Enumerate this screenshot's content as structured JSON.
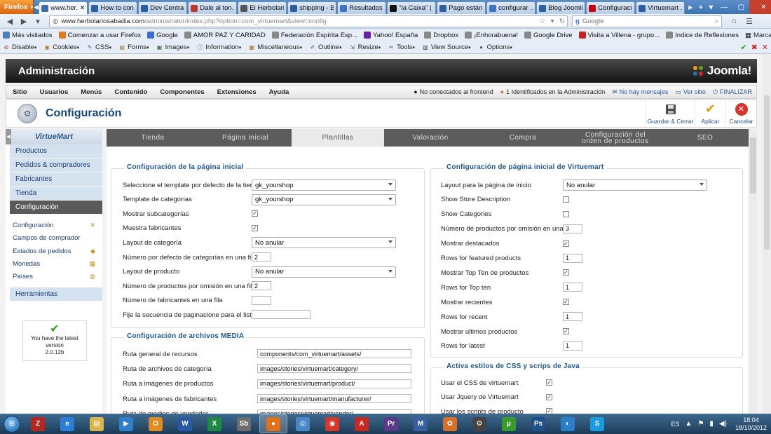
{
  "browser": {
    "menu_button": "Firefox",
    "tabs": [
      {
        "label": "www.her...",
        "color": "#3a6fa8",
        "glyph": "",
        "active": true
      },
      {
        "label": "How to con...",
        "color": "#2c5fa0",
        "glyph": "",
        "active": false
      },
      {
        "label": "Dev Central ...",
        "color": "#2a5d9f",
        "glyph": "",
        "active": false
      },
      {
        "label": "Dale al ton...",
        "color": "#c0392b",
        "glyph": "",
        "active": false
      },
      {
        "label": "El Herbolari...",
        "color": "#555555",
        "glyph": "",
        "active": false
      },
      {
        "label": "shipping - B...",
        "color": "#2c5fa0",
        "glyph": "",
        "active": false
      },
      {
        "label": "Resultados ...",
        "color": "#3b73c7",
        "glyph": "",
        "active": false
      },
      {
        "label": "\"la Caixa\" | ...",
        "color": "#111111",
        "glyph": "",
        "active": false
      },
      {
        "label": "Pago están...",
        "color": "#2c5fa0",
        "glyph": "",
        "active": false
      },
      {
        "label": "configurar ...",
        "color": "#3b73c7",
        "glyph": "",
        "active": false
      },
      {
        "label": "Blog Joomli...",
        "color": "#2c5fa0",
        "glyph": "",
        "active": false
      },
      {
        "label": "Configuraci...",
        "color": "#cc0000",
        "glyph": "",
        "active": false
      },
      {
        "label": "Virtuemart ...",
        "color": "#2c5fa0",
        "glyph": "",
        "active": false
      }
    ],
    "url_host": "www.herbolariosabadia.com",
    "url_path": "/administrator/index.php?option=com_virtuemart&view=config",
    "search_placeholder": "Google",
    "bookmarks": [
      {
        "label": "Más visitados",
        "color": "#4a7fc0"
      },
      {
        "label": "Comenzar a usar Firefox",
        "color": "#e07b1a"
      },
      {
        "label": "Google",
        "color": "#3a6fd8"
      },
      {
        "label": "AMOR PAZ Y CARIDAD",
        "color": "#888888"
      },
      {
        "label": "Federación Espírita Esp...",
        "color": "#888888"
      },
      {
        "label": "Yahoo! España",
        "color": "#6a1fa8"
      },
      {
        "label": "Dropbox",
        "color": "#888888"
      },
      {
        "label": "¡Enhorabuena!",
        "color": "#888888"
      },
      {
        "label": "Google Drive",
        "color": "#888888"
      },
      {
        "label": "Visita a Villena - grupo...",
        "color": "#cc2222"
      },
      {
        "label": "Indice de Reflexiones",
        "color": "#888888"
      }
    ],
    "bookmarks_right": "Marcadores",
    "webdev_items": [
      "Disable",
      "Cookies",
      "CSS",
      "Forms",
      "Images",
      "Information",
      "Miscellaneous",
      "Outline",
      "Resize",
      "Tools",
      "View Source",
      "Options"
    ]
  },
  "admin": {
    "header_title": "Administración",
    "logo_text": "Joomla!",
    "menu": [
      "Sitio",
      "Usuarios",
      "Menús",
      "Contenido",
      "Componentes",
      "Extensiones",
      "Ayuda"
    ],
    "status": {
      "frontend": "No conectados al frontend",
      "admins": "1 Identificados en la Administración",
      "messages": "No hay mensajes",
      "view_site": "Ver sitio",
      "logout": "FINALIZAR"
    },
    "page_title": "Configuración",
    "toolbar": {
      "save_close": "Guardar & Cerrar",
      "apply": "Aplicar",
      "cancel": "Cancelar"
    }
  },
  "sidebar": {
    "logo": "VirtueMart",
    "groups": [
      "Productos",
      "Pedidos & compradores",
      "Fabricantes",
      "Tienda",
      "Configuración"
    ],
    "items": [
      "Configuración",
      "Campos de comprador",
      "Estados de pedidos",
      "Monedas",
      "Países"
    ],
    "tools": "Herramientas",
    "latest": {
      "line1": "You have the latest",
      "line2": "version",
      "version": "2.0.12b"
    }
  },
  "tabs": [
    "Tienda",
    "Página inicial",
    "Plantillas",
    "Valoración",
    "Compra",
    "Configuración del orden de productos",
    "SEO"
  ],
  "home_config": {
    "title": "Configuración de la página inicial",
    "rows": [
      {
        "label": "Seleccione el template por defecto de la tienda",
        "type": "select",
        "value": "gk_yourshop"
      },
      {
        "label": "Template de categorías",
        "type": "select",
        "value": "gk_yourshop"
      },
      {
        "label": "Mostrar subcategorías",
        "type": "checkbox",
        "value": "✓"
      },
      {
        "label": "Muestra fabricantes",
        "type": "checkbox",
        "value": "✓"
      },
      {
        "label": "Layout de categoría",
        "type": "select",
        "value": "No anular"
      },
      {
        "label": "Número por defecto de categorías en una fila",
        "type": "input",
        "value": "2"
      },
      {
        "label": "Layout de producto",
        "type": "select",
        "value": "No anular"
      },
      {
        "label": "Número de productos por omisión en una fila",
        "type": "input",
        "value": "2"
      },
      {
        "label": "Número de fabricantes en una fila",
        "type": "input",
        "value": ""
      },
      {
        "label": "Fije la secuencia de paginacione para el listado",
        "type": "input-wide",
        "value": ""
      }
    ]
  },
  "media": {
    "title": "Configuración de archivos MEDIA",
    "rows": [
      {
        "label": "Ruta general de recursos",
        "value": "components/com_virtuemart/assets/"
      },
      {
        "label": "Ruta de archivos de categoría",
        "value": "images/stories/virtuemart/category/"
      },
      {
        "label": "Ruta a imágenes de productos",
        "value": "images/stories/virtuemart/product/"
      },
      {
        "label": "Ruta a imágenes de fabricantes",
        "value": "images/stories/virtuemart/manufacturer/"
      },
      {
        "label": "Ruta de medios de vendedor",
        "value": "images/stories/virtuemart/vendor/"
      }
    ]
  },
  "vm_home": {
    "title": "Configuración de página inicial de Virtuemart",
    "rows": [
      {
        "label": "Layout para la página de inicio",
        "type": "select",
        "value": "No anular"
      },
      {
        "label": "Show Store Description",
        "type": "checkbox",
        "value": ""
      },
      {
        "label": "Show Categories",
        "type": "checkbox",
        "value": ""
      },
      {
        "label": "Número de productos por omisión en una fila",
        "type": "input",
        "value": "3"
      },
      {
        "label": "Mostrar destacados",
        "type": "checkbox",
        "value": "✓"
      },
      {
        "label": "Rows for featured products",
        "type": "input",
        "value": "1"
      },
      {
        "label": "Mostrar Top Ten de productos",
        "type": "checkbox",
        "value": "✓"
      },
      {
        "label": "Rows for Top ten",
        "type": "input",
        "value": "1"
      },
      {
        "label": "Mostrar recientes",
        "type": "checkbox",
        "value": "✓"
      },
      {
        "label": "Rows for recent",
        "type": "input",
        "value": "1"
      },
      {
        "label": "Mostrar últimos productos",
        "type": "checkbox",
        "value": "✓"
      },
      {
        "label": "Rows for latest",
        "type": "input",
        "value": "1"
      }
    ]
  },
  "css_js": {
    "title": "Activa estilos de CSS y scrips de Java",
    "rows": [
      {
        "label": "Usar el CSS de virtuemart",
        "value": "✓"
      },
      {
        "label": "Usar Jquery de Virtuemart",
        "value": "✓"
      },
      {
        "label": "Usar los scripts de producto",
        "value": "✓"
      }
    ]
  },
  "taskbar": {
    "apps": [
      {
        "name": "filezilla",
        "color": "#b5271f",
        "glyph": "Z"
      },
      {
        "name": "internet-explorer",
        "color": "#2a7fd4",
        "glyph": "e"
      },
      {
        "name": "file-explorer",
        "color": "#d9b54a",
        "glyph": "▤"
      },
      {
        "name": "media-player",
        "color": "#2f7fc8",
        "glyph": "▶"
      },
      {
        "name": "outlook",
        "color": "#e08a1f",
        "glyph": "O"
      },
      {
        "name": "word",
        "color": "#2b58a6",
        "glyph": "W"
      },
      {
        "name": "excel",
        "color": "#1f8a43",
        "glyph": "X"
      },
      {
        "name": "sb-app",
        "color": "#6d6d6d",
        "glyph": "Sb"
      },
      {
        "name": "firefox",
        "color": "#e0701a",
        "glyph": "●"
      },
      {
        "name": "network-tool",
        "color": "#4a86c8",
        "glyph": "◎"
      },
      {
        "name": "chrome",
        "color": "#d9362a",
        "glyph": "◉"
      },
      {
        "name": "acrobat",
        "color": "#c8281f",
        "glyph": "A"
      },
      {
        "name": "premiere",
        "color": "#5a3a8a",
        "glyph": "Pr"
      },
      {
        "name": "manual-tool",
        "color": "#3a5fa0",
        "glyph": "M"
      },
      {
        "name": "paint-tool",
        "color": "#d9702a",
        "glyph": "✿"
      },
      {
        "name": "process-tool",
        "color": "#444444",
        "glyph": "⚙"
      },
      {
        "name": "utorrent",
        "color": "#3a9a2a",
        "glyph": "µ"
      },
      {
        "name": "photoshop",
        "color": "#1f4f8a",
        "glyph": "Ps"
      },
      {
        "name": "remote-tool",
        "color": "#2a7fc8",
        "glyph": "◐"
      },
      {
        "name": "skype",
        "color": "#1a9ae0",
        "glyph": "S"
      }
    ],
    "language": "ES",
    "time": "18:04",
    "date": "18/10/2012"
  }
}
